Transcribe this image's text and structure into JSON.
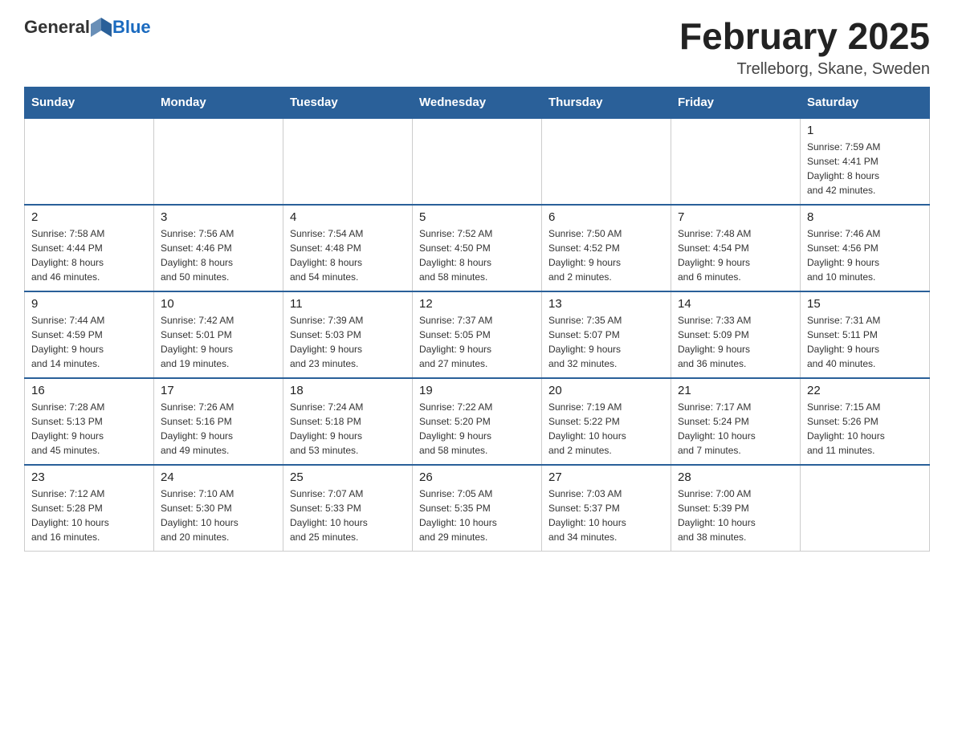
{
  "header": {
    "logo_general": "General",
    "logo_blue": "Blue",
    "month_title": "February 2025",
    "location": "Trelleborg, Skane, Sweden"
  },
  "weekdays": [
    "Sunday",
    "Monday",
    "Tuesday",
    "Wednesday",
    "Thursday",
    "Friday",
    "Saturday"
  ],
  "weeks": [
    [
      {
        "day": "",
        "info": ""
      },
      {
        "day": "",
        "info": ""
      },
      {
        "day": "",
        "info": ""
      },
      {
        "day": "",
        "info": ""
      },
      {
        "day": "",
        "info": ""
      },
      {
        "day": "",
        "info": ""
      },
      {
        "day": "1",
        "info": "Sunrise: 7:59 AM\nSunset: 4:41 PM\nDaylight: 8 hours\nand 42 minutes."
      }
    ],
    [
      {
        "day": "2",
        "info": "Sunrise: 7:58 AM\nSunset: 4:44 PM\nDaylight: 8 hours\nand 46 minutes."
      },
      {
        "day": "3",
        "info": "Sunrise: 7:56 AM\nSunset: 4:46 PM\nDaylight: 8 hours\nand 50 minutes."
      },
      {
        "day": "4",
        "info": "Sunrise: 7:54 AM\nSunset: 4:48 PM\nDaylight: 8 hours\nand 54 minutes."
      },
      {
        "day": "5",
        "info": "Sunrise: 7:52 AM\nSunset: 4:50 PM\nDaylight: 8 hours\nand 58 minutes."
      },
      {
        "day": "6",
        "info": "Sunrise: 7:50 AM\nSunset: 4:52 PM\nDaylight: 9 hours\nand 2 minutes."
      },
      {
        "day": "7",
        "info": "Sunrise: 7:48 AM\nSunset: 4:54 PM\nDaylight: 9 hours\nand 6 minutes."
      },
      {
        "day": "8",
        "info": "Sunrise: 7:46 AM\nSunset: 4:56 PM\nDaylight: 9 hours\nand 10 minutes."
      }
    ],
    [
      {
        "day": "9",
        "info": "Sunrise: 7:44 AM\nSunset: 4:59 PM\nDaylight: 9 hours\nand 14 minutes."
      },
      {
        "day": "10",
        "info": "Sunrise: 7:42 AM\nSunset: 5:01 PM\nDaylight: 9 hours\nand 19 minutes."
      },
      {
        "day": "11",
        "info": "Sunrise: 7:39 AM\nSunset: 5:03 PM\nDaylight: 9 hours\nand 23 minutes."
      },
      {
        "day": "12",
        "info": "Sunrise: 7:37 AM\nSunset: 5:05 PM\nDaylight: 9 hours\nand 27 minutes."
      },
      {
        "day": "13",
        "info": "Sunrise: 7:35 AM\nSunset: 5:07 PM\nDaylight: 9 hours\nand 32 minutes."
      },
      {
        "day": "14",
        "info": "Sunrise: 7:33 AM\nSunset: 5:09 PM\nDaylight: 9 hours\nand 36 minutes."
      },
      {
        "day": "15",
        "info": "Sunrise: 7:31 AM\nSunset: 5:11 PM\nDaylight: 9 hours\nand 40 minutes."
      }
    ],
    [
      {
        "day": "16",
        "info": "Sunrise: 7:28 AM\nSunset: 5:13 PM\nDaylight: 9 hours\nand 45 minutes."
      },
      {
        "day": "17",
        "info": "Sunrise: 7:26 AM\nSunset: 5:16 PM\nDaylight: 9 hours\nand 49 minutes."
      },
      {
        "day": "18",
        "info": "Sunrise: 7:24 AM\nSunset: 5:18 PM\nDaylight: 9 hours\nand 53 minutes."
      },
      {
        "day": "19",
        "info": "Sunrise: 7:22 AM\nSunset: 5:20 PM\nDaylight: 9 hours\nand 58 minutes."
      },
      {
        "day": "20",
        "info": "Sunrise: 7:19 AM\nSunset: 5:22 PM\nDaylight: 10 hours\nand 2 minutes."
      },
      {
        "day": "21",
        "info": "Sunrise: 7:17 AM\nSunset: 5:24 PM\nDaylight: 10 hours\nand 7 minutes."
      },
      {
        "day": "22",
        "info": "Sunrise: 7:15 AM\nSunset: 5:26 PM\nDaylight: 10 hours\nand 11 minutes."
      }
    ],
    [
      {
        "day": "23",
        "info": "Sunrise: 7:12 AM\nSunset: 5:28 PM\nDaylight: 10 hours\nand 16 minutes."
      },
      {
        "day": "24",
        "info": "Sunrise: 7:10 AM\nSunset: 5:30 PM\nDaylight: 10 hours\nand 20 minutes."
      },
      {
        "day": "25",
        "info": "Sunrise: 7:07 AM\nSunset: 5:33 PM\nDaylight: 10 hours\nand 25 minutes."
      },
      {
        "day": "26",
        "info": "Sunrise: 7:05 AM\nSunset: 5:35 PM\nDaylight: 10 hours\nand 29 minutes."
      },
      {
        "day": "27",
        "info": "Sunrise: 7:03 AM\nSunset: 5:37 PM\nDaylight: 10 hours\nand 34 minutes."
      },
      {
        "day": "28",
        "info": "Sunrise: 7:00 AM\nSunset: 5:39 PM\nDaylight: 10 hours\nand 38 minutes."
      },
      {
        "day": "",
        "info": ""
      }
    ]
  ]
}
